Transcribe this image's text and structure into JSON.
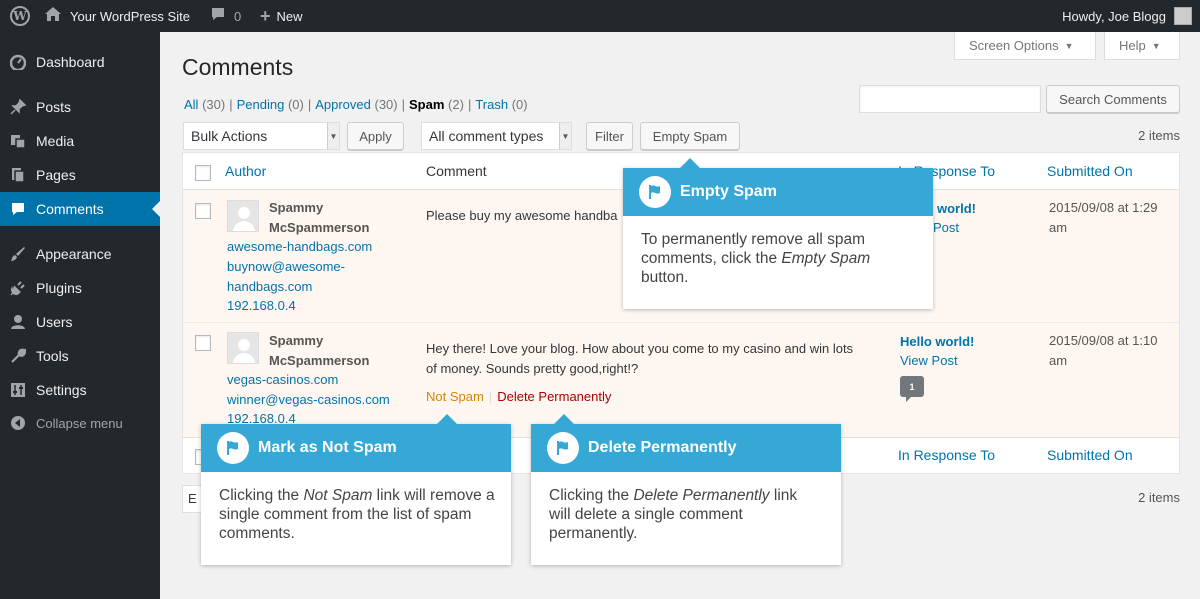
{
  "adminbar": {
    "site_name": "Your WordPress Site",
    "comment_count": "0",
    "new_label": "New",
    "howdy": "Howdy, Joe Blogg"
  },
  "sidebar": {
    "items": [
      {
        "label": "Dashboard",
        "icon": "dashboard-icon"
      },
      {
        "label": "Posts",
        "icon": "pin-icon"
      },
      {
        "label": "Media",
        "icon": "media-icon"
      },
      {
        "label": "Pages",
        "icon": "pages-icon"
      },
      {
        "label": "Comments",
        "icon": "comment-icon"
      },
      {
        "label": "Appearance",
        "icon": "brush-icon"
      },
      {
        "label": "Plugins",
        "icon": "plug-icon"
      },
      {
        "label": "Users",
        "icon": "user-icon"
      },
      {
        "label": "Tools",
        "icon": "wrench-icon"
      },
      {
        "label": "Settings",
        "icon": "settings-icon"
      }
    ],
    "collapse_label": "Collapse menu"
  },
  "screen_options_label": "Screen Options",
  "help_label": "Help",
  "page_title": "Comments",
  "filters": {
    "all": "All",
    "all_count": "(30)",
    "pending": "Pending",
    "pending_count": "(0)",
    "approved": "Approved",
    "approved_count": "(30)",
    "spam": "Spam",
    "spam_count": "(2)",
    "trash": "Trash",
    "trash_count": "(0)"
  },
  "search_button": "Search Comments",
  "bulk_actions": "Bulk Actions",
  "apply_label": "Apply",
  "comment_types": "All comment types",
  "filter_label": "Filter",
  "empty_spam_label": "Empty Spam",
  "items_count": "2 items",
  "table": {
    "col_author": "Author",
    "col_comment": "Comment",
    "col_response": "In Response To",
    "col_submitted": "Submitted On",
    "rows": [
      {
        "author_line1": "Spammy",
        "author_line2": "McSpammerson",
        "site": "awesome-handbags.com",
        "email_line1": "buynow@awesome-",
        "email_line2": "handbags.com",
        "ip": "192.168.0.4",
        "comment": "Please buy my awesome handba",
        "response_title": "world!",
        "response_view": "Post",
        "submitted_line1": "2015/09/08 at 1:29",
        "submitted_line2": "am"
      },
      {
        "author_line1": "Spammy",
        "author_line2": "McSpammerson",
        "site": "vegas-casinos.com",
        "email": "winner@vegas-casinos.com",
        "ip": "192.168.0.4",
        "comment_line1": "Hey there! Love your blog. How about you come to my casino and win lots",
        "comment_line2": "of money. Sounds pretty good,right!?",
        "action_not_spam": "Not Spam",
        "action_delete": "Delete Permanently",
        "response_title": "Hello world!",
        "response_view": "View Post",
        "bubble_count": "1",
        "submitted_line1": "2015/09/08 at 1:10",
        "submitted_line2": "am"
      }
    ]
  },
  "bottom_select_label": "E",
  "callouts": {
    "empty_spam": {
      "title": "Empty Spam",
      "body_pre": "To permanently remove all spam comments, click the ",
      "body_em": "Empty Spam",
      "body_post": " button."
    },
    "not_spam": {
      "title": "Mark as Not Spam",
      "body_pre": "Clicking the ",
      "body_em": "Not Spam",
      "body_post": " link will remove a single comment from the list of spam comments."
    },
    "delete": {
      "title": "Delete Permanently",
      "body_pre": "Clicking the ",
      "body_em": "Delete Permanently",
      "body_post": " link will delete a single comment permanently."
    }
  },
  "colors": {
    "adminbar": "#23282d",
    "accent": "#0073aa",
    "callout": "#35a8d5",
    "spam_row": "#fef7f1",
    "not_spam": "#d98500",
    "delete": "#a00000"
  }
}
